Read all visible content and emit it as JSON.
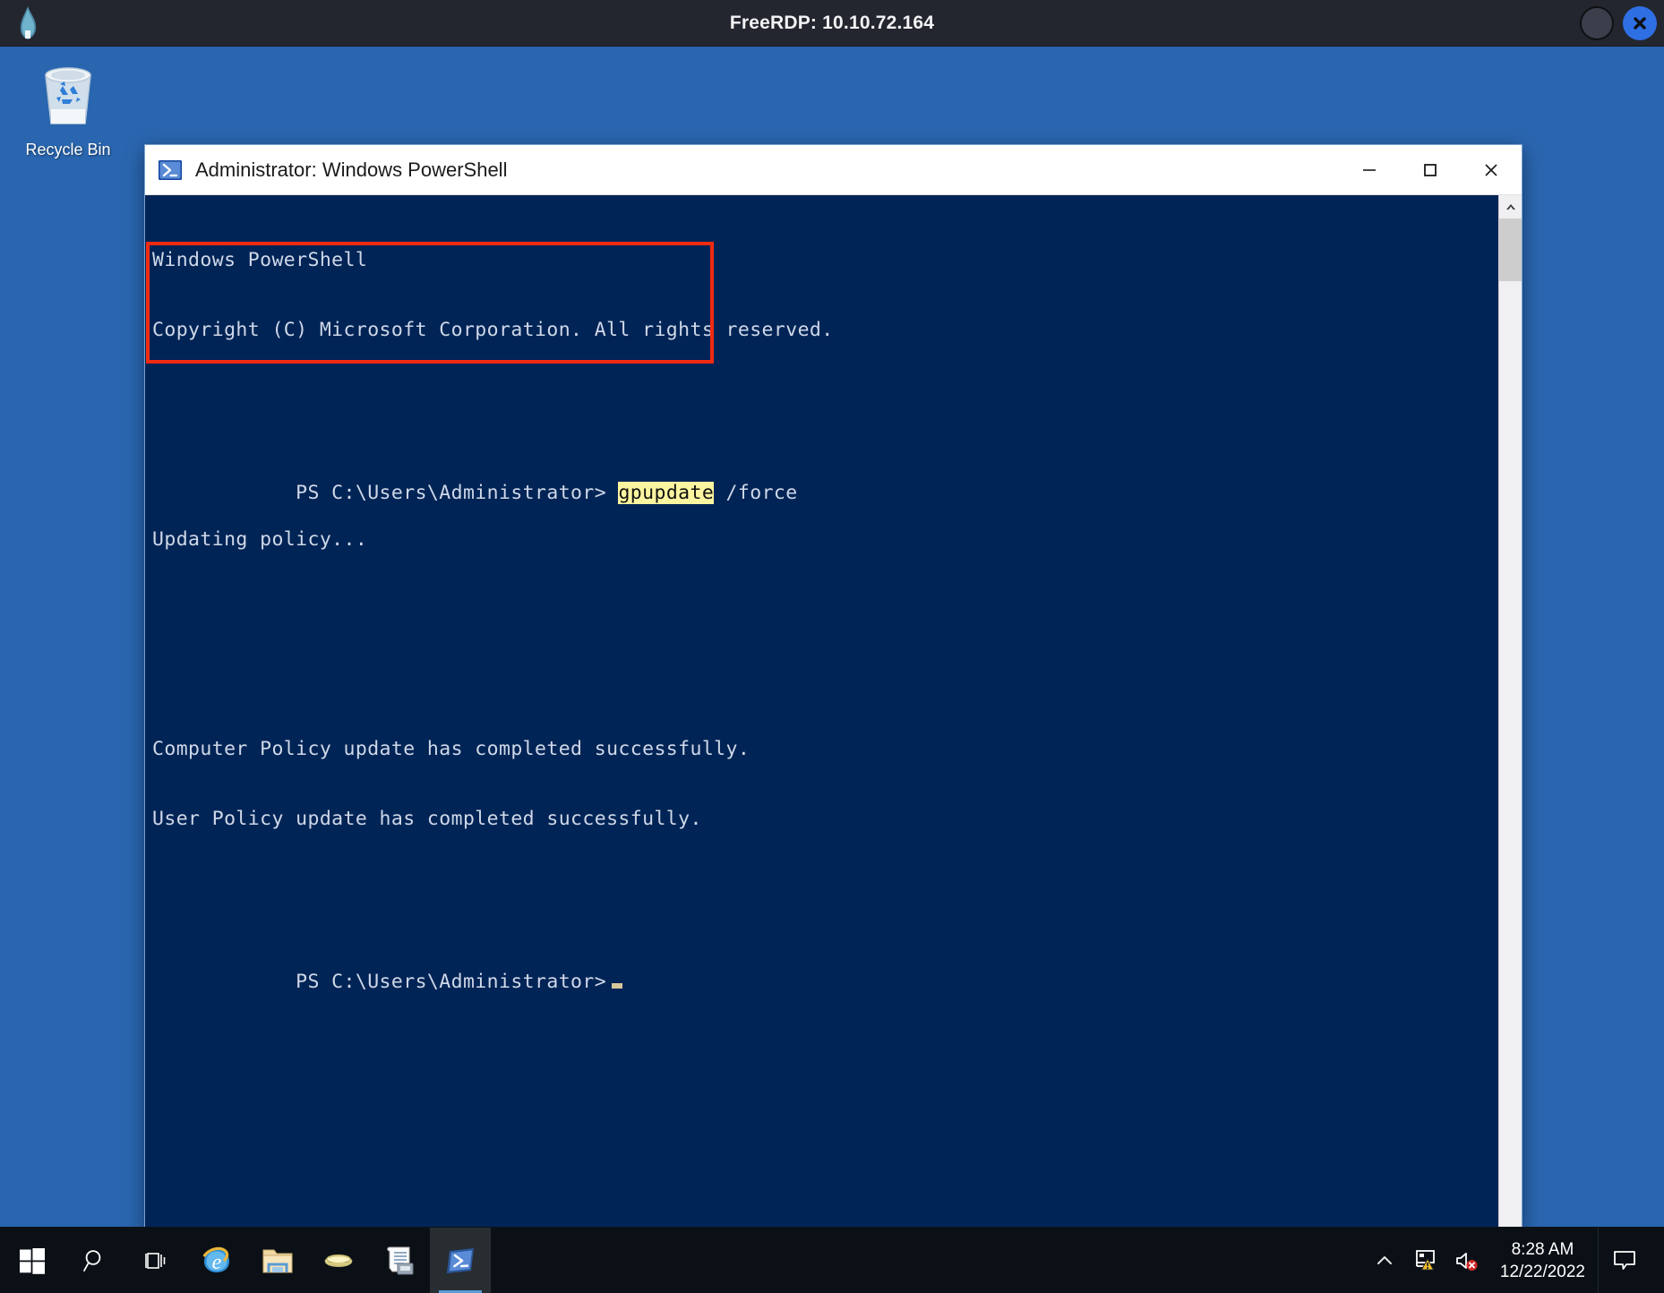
{
  "rdp": {
    "title": "FreeRDP: 10.10.72.164",
    "logo_icon": "freerdp-flame-icon",
    "minimize_icon": "circle-minimize-icon",
    "close_icon": "circle-close-icon",
    "accent_color": "#2f6fe4",
    "titlebar_color": "#23262e"
  },
  "desktop": {
    "background_color": "#2a66b0",
    "icons": [
      {
        "name": "recycle-bin",
        "label": "Recycle Bin",
        "icon": "recycle-bin-icon"
      }
    ]
  },
  "powershell": {
    "title": "Administrator: Windows PowerShell",
    "app_icon": "powershell-prompt-icon",
    "background_color": "#012456",
    "controls": {
      "minimize": "—",
      "maximize": "□",
      "close": "✕"
    },
    "console": {
      "header_line_1": "Windows PowerShell",
      "header_line_2": "Copyright (C) Microsoft Corporation. All rights reserved.",
      "prompt_1": "PS C:\\Users\\Administrator> ",
      "command": "gpupdate",
      "command_args": " /force",
      "output_line_1": "Updating policy...",
      "output_line_2": "Computer Policy update has completed successfully.",
      "output_line_3": "User Policy update has completed successfully.",
      "prompt_2": "PS C:\\Users\\Administrator>",
      "highlight_color": "#fbf5a0",
      "text_color": "#cfd8e8",
      "cursor": "block-underscore-cursor"
    },
    "annotation": {
      "name": "red-highlight-box",
      "color": "#f22b13"
    },
    "scrollbar": {
      "up_arrow": "▲",
      "down_arrow": "▼"
    }
  },
  "taskbar": {
    "background_color": "#0b1016",
    "items": [
      {
        "name": "start",
        "icon": "windows-start-icon",
        "label": "Start",
        "active": false
      },
      {
        "name": "search",
        "icon": "search-icon",
        "label": "Search",
        "active": false
      },
      {
        "name": "task-view",
        "icon": "task-view-icon",
        "label": "Task View",
        "active": false
      },
      {
        "name": "internet-explorer",
        "icon": "internet-explorer-icon",
        "label": "Internet Explorer",
        "active": false
      },
      {
        "name": "file-explorer",
        "icon": "file-explorer-icon",
        "label": "File Explorer",
        "active": false
      },
      {
        "name": "server-manager",
        "icon": "server-manager-icon",
        "label": "Server Manager",
        "active": false
      },
      {
        "name": "event-viewer",
        "icon": "event-viewer-icon",
        "label": "Event Viewer",
        "active": false
      },
      {
        "name": "powershell",
        "icon": "powershell-prompt-icon",
        "label": "Windows PowerShell",
        "active": true
      }
    ],
    "tray": {
      "show_hidden_icons": "show-hidden-icons-chevron",
      "network": "network-warning-icon",
      "volume": "volume-muted-icon",
      "action_center": "action-center-icon",
      "time": "8:28 AM",
      "date": "12/22/2022"
    }
  }
}
